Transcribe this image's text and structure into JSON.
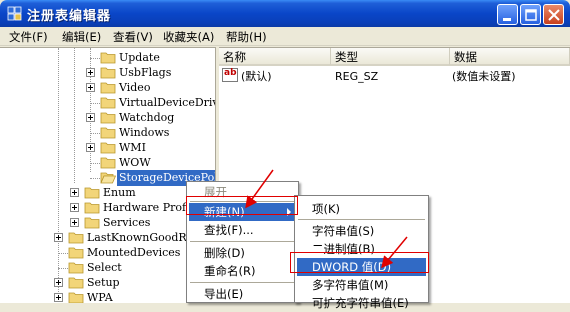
{
  "window": {
    "title": "注册表编辑器"
  },
  "menu": [
    "文件(F)",
    "编辑(E)",
    "查看(V)",
    "收藏夹(A)",
    "帮助(H)"
  ],
  "tree": {
    "children_of_control": [
      "Update",
      "UsbFlags",
      "Video",
      "VirtualDeviceDrivers",
      "Watchdog",
      "Windows",
      "WMI",
      "WOW",
      "StorageDevicePolicies"
    ],
    "children_of_controlset": [
      "Enum",
      "Hardware Profiles",
      "Services"
    ],
    "system_keys": [
      "LastKnownGoodRecovery",
      "MountedDevices",
      "Select",
      "Setup",
      "WPA"
    ]
  },
  "list": {
    "columns": [
      "名称",
      "类型",
      "数据"
    ],
    "rows": [
      {
        "name": "(默认)",
        "type": "REG_SZ",
        "data": "(数值未设置)"
      }
    ]
  },
  "context_menu": {
    "items": [
      "展开",
      "新建(N)",
      "查找(F)...",
      "删除(D)",
      "重命名(R)",
      "导出(E)"
    ]
  },
  "submenu": {
    "items": [
      "项(K)",
      "字符串值(S)",
      "二进制值(B)",
      "DWORD 值(D)",
      "多字符串值(M)",
      "可扩充字符串值(E)"
    ]
  },
  "colors": {
    "selection": "#316ac5",
    "annotation": "#e00000",
    "titlebar": "#0a46c8"
  }
}
